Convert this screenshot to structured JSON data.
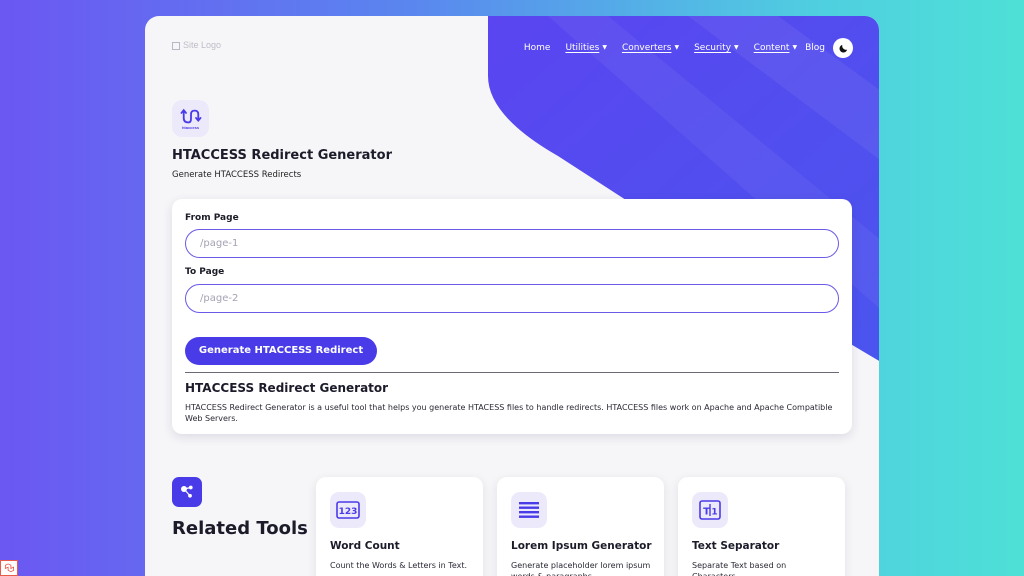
{
  "header": {
    "logo_alt": "Site Logo",
    "nav": [
      {
        "label": "Home",
        "dropdown": false
      },
      {
        "label": "Utilities",
        "dropdown": true
      },
      {
        "label": "Converters",
        "dropdown": true
      },
      {
        "label": "Security",
        "dropdown": true
      },
      {
        "label": "Content",
        "dropdown": true
      },
      {
        "label": "Blog",
        "dropdown": false
      }
    ],
    "theme_icon": "moon-icon"
  },
  "tool": {
    "icon": "htaccess-icon",
    "icon_caption": "htaccess",
    "title": "HTACCESS Redirect Generator",
    "subtitle": "Generate HTACCESS Redirects"
  },
  "form": {
    "from_label": "From Page",
    "from_placeholder": "/page-1",
    "to_label": "To Page",
    "to_placeholder": "/page-2",
    "submit_label": "Generate HTACCESS Redirect"
  },
  "description": {
    "title": "HTACCESS Redirect Generator",
    "text": "HTACCESS Redirect Generator is a useful tool that helps you generate HTACESS files to handle redirects. HTACCESS files work on Apache and Apache Compatible Web Servers."
  },
  "related": {
    "icon": "share-nodes-icon",
    "title": "Related Tools",
    "tools": [
      {
        "icon": "number-123-icon",
        "name": "Word Count",
        "desc": "Count the Words & Letters in Text."
      },
      {
        "icon": "text-lines-icon",
        "name": "Lorem Ipsum Generator",
        "desc": "Generate placeholder lorem ipsum words & paragraphs."
      },
      {
        "icon": "text-separator-icon",
        "name": "Text Separator",
        "desc": "Separate Text based on Characters."
      }
    ]
  },
  "colors": {
    "accent": "#4a3be8",
    "icon_bg": "#ece9fb",
    "page_bg": "#f6f6f8"
  }
}
